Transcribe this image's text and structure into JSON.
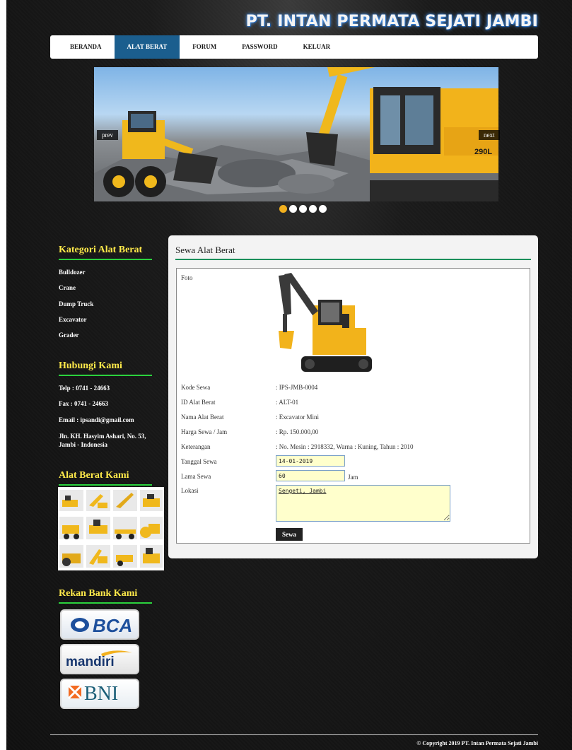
{
  "site": {
    "title": "PT. INTAN PERMATA SEJATI JAMBI"
  },
  "nav": {
    "items": [
      {
        "label": "BERANDA"
      },
      {
        "label": "ALAT BERAT"
      },
      {
        "label": "FORUM"
      },
      {
        "label": "PASSWORD"
      },
      {
        "label": "KELUAR"
      }
    ],
    "active_index": 1
  },
  "slider": {
    "prev_label": "prev",
    "next_label": "next",
    "dot_count": 5,
    "active_dot": 0,
    "image_text": "290L"
  },
  "sidebar": {
    "kategori": {
      "title": "Kategori Alat Berat",
      "items": [
        {
          "label": "Bulldozer"
        },
        {
          "label": "Crane"
        },
        {
          "label": "Dump Truck"
        },
        {
          "label": "Excavator"
        },
        {
          "label": "Grader"
        }
      ]
    },
    "hubungi": {
      "title": "Hubungi Kami",
      "telp": "Telp : 0741 - 24663",
      "fax": "Fax : 0741 - 24663",
      "email": "Email : ipsandi@gmail.com",
      "address": "Jln. KH. Hasyim Ashari, No. 53, Jambi - Indonesia"
    },
    "alat": {
      "title": "Alat Berat Kami"
    },
    "bank": {
      "title": "Rekan Bank Kami",
      "logos": [
        "BCA",
        "mandiri",
        "BNI"
      ]
    }
  },
  "content": {
    "title": "Sewa Alat Berat",
    "foto_label": "Foto",
    "rows": [
      {
        "label": "Kode Sewa",
        "value": ": IPS-JMB-0004"
      },
      {
        "label": "ID Alat Berat",
        "value": ": ALT-01"
      },
      {
        "label": "Nama Alat Berat",
        "value": ": Excavator Mini"
      },
      {
        "label": "Harga Sewa / Jam",
        "value": ": Rp. 150.000,00"
      },
      {
        "label": "Keterangan",
        "value": ": No. Mesin : 2918332, Warna : Kuning, Tahun : 2010"
      }
    ],
    "tanggal": {
      "label": "Tanggal Sewa",
      "value": "14-01-2019"
    },
    "lama": {
      "label": "Lama Sewa",
      "value": "60",
      "unit": "Jam"
    },
    "lokasi": {
      "label": "Lokasi",
      "value": "Sengeti, Jambi"
    },
    "submit_label": "Sewa"
  },
  "footer": {
    "copyright": "© Copyright 2019 PT. Intan Permata Sejati Jambi"
  },
  "colors": {
    "nav_active": "#1b5e8e",
    "side_title": "#ffea4a",
    "accent_green": "#2bd23d",
    "content_rule": "#1b8f5a",
    "input_bg": "#ffffcc"
  }
}
